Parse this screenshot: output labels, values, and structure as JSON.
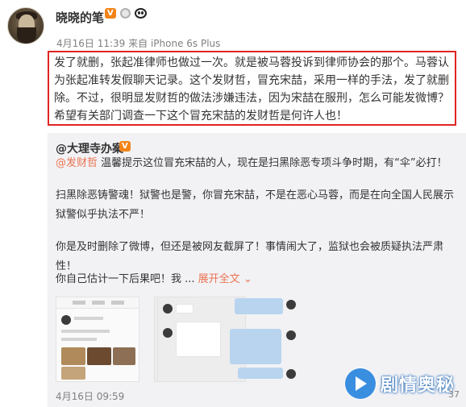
{
  "post": {
    "author": "晓晓的笔",
    "badges": {
      "vip": "V"
    },
    "time": "4月16日 11:39",
    "source": "来自 iPhone 6s Plus",
    "body": "发了就删，张起准律师也做过一次。就是被马蓉投诉到律师协会的那个。马蓉认为张起准转发假聊天记录。这个发财哲，冒充宋喆，采用一样的手法，发了就删除。不过，很明显发财哲的做法涉嫌违法，因为宋喆在服刑，怎么可能发微博？希望有关部门调查一下这个冒充宋喆的发财哲是何许人也！"
  },
  "repost": {
    "author": "@大理寺办案",
    "vip": "V",
    "line1_mention": "@发财哲",
    "line1_text": " 温馨提示这位冒充宋喆的人，现在是扫黑除恶专项斗争时期，有“伞”必打！",
    "line2": "扫黑除恶铸警魂！狱警也是警，你冒充宋喆，不是在恶心马蓉，而是在向全国人民展示狱警似乎执法不严！",
    "line3": "你是及时删除了微博，但还是被网友截屏了！事情闹大了，监狱也会被质疑执法严肃性！",
    "line4": "你自己估计一下后果吧！我 ...",
    "expand": "展开全文",
    "expand_icon": "chevron-down-icon",
    "time": "4月16日 09:59",
    "count": "37"
  },
  "watermark": {
    "text": "剧情奥秘"
  },
  "colors": {
    "highlight_border": "#e02424",
    "link": "#eb7350",
    "repost_bg": "#f2f2f5",
    "meta": "#808080"
  }
}
